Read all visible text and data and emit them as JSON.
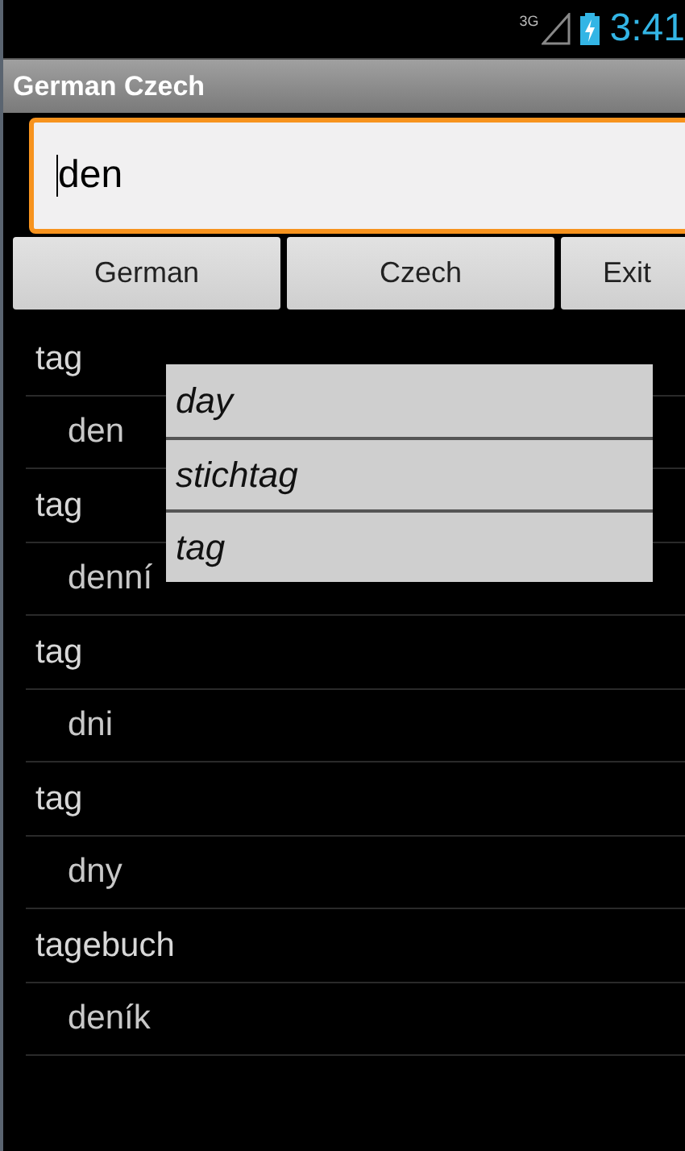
{
  "status_bar": {
    "network": "3G",
    "time": "3:41"
  },
  "window": {
    "title": "German Czech"
  },
  "search": {
    "value": "den",
    "focused": true
  },
  "buttons": [
    "German",
    "Czech",
    "Exit"
  ],
  "results": [
    {
      "kind": "word",
      "text": "tag"
    },
    {
      "kind": "translation",
      "text": "den"
    },
    {
      "kind": "word",
      "text": "tag"
    },
    {
      "kind": "translation",
      "text": "denní"
    },
    {
      "kind": "word",
      "text": "tag"
    },
    {
      "kind": "translation",
      "text": "dni"
    },
    {
      "kind": "word",
      "text": "tag"
    },
    {
      "kind": "translation",
      "text": "dny"
    },
    {
      "kind": "word",
      "text": "tagebuch"
    },
    {
      "kind": "translation",
      "text": "deník"
    }
  ],
  "suggestions": [
    "day",
    "stichtag",
    "tag"
  ]
}
